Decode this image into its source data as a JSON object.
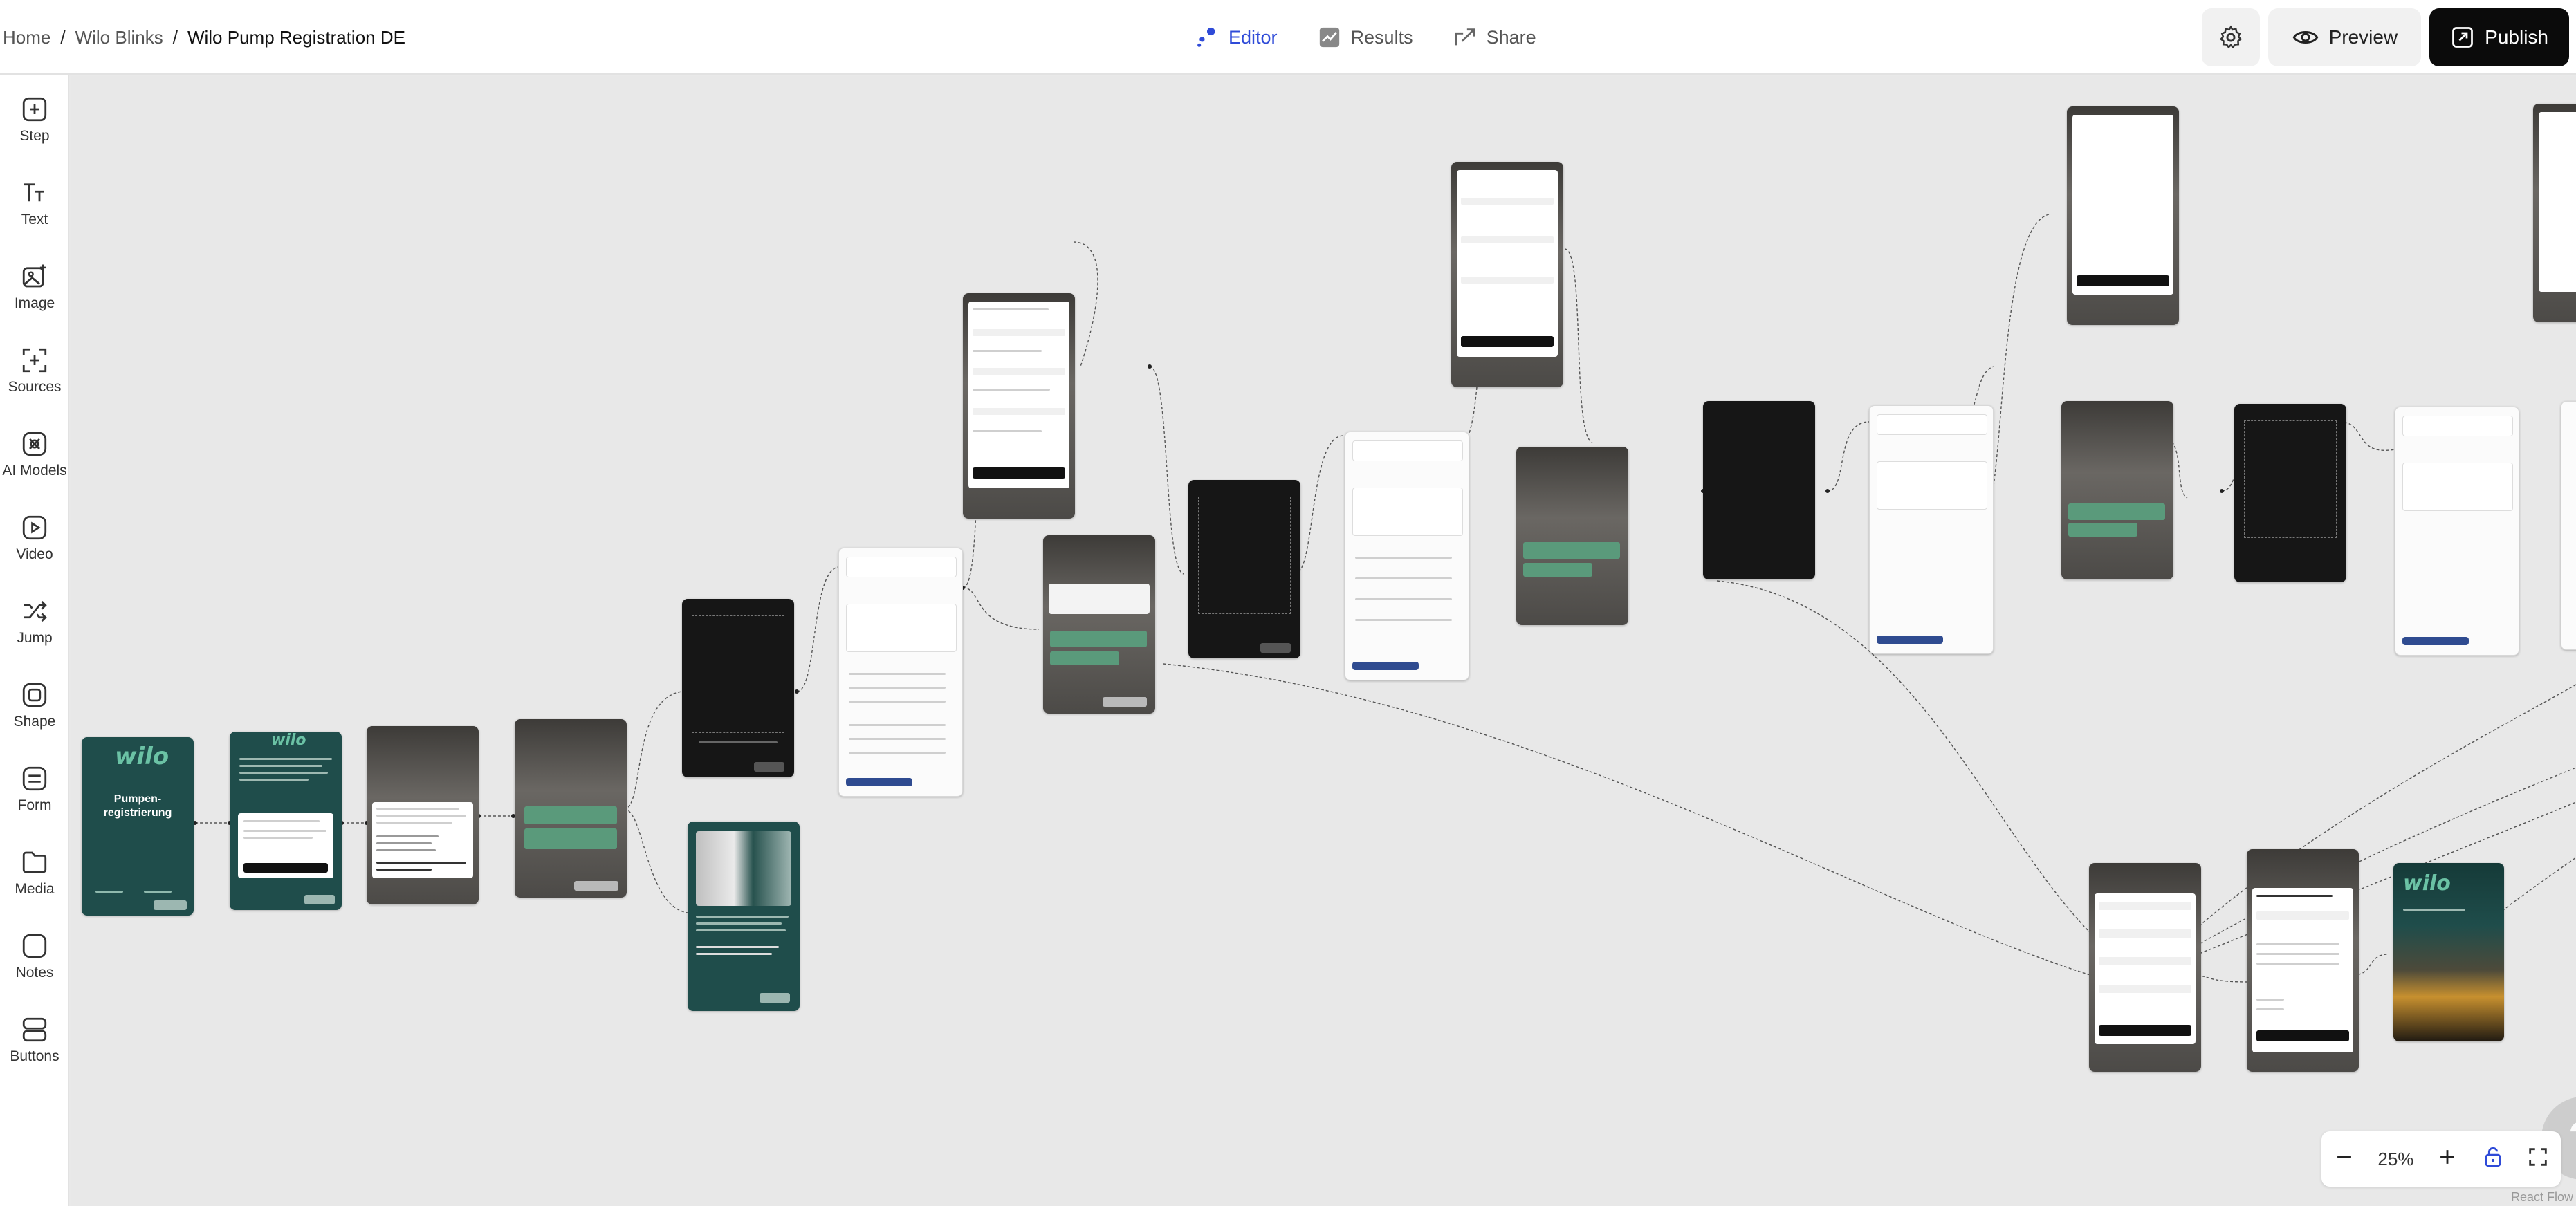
{
  "breadcrumb": {
    "home": "Home",
    "project": "Wilo Blinks",
    "current": "Wilo Pump Registration DE"
  },
  "tabs": [
    {
      "label": "Editor"
    },
    {
      "label": "Results"
    },
    {
      "label": "Share"
    }
  ],
  "actions": {
    "preview": "Preview",
    "publish": "Publish"
  },
  "tools": [
    "Step",
    "Text",
    "Image",
    "Sources",
    "AI Models",
    "Video",
    "Jump",
    "Shape",
    "Form",
    "Media",
    "Notes",
    "Buttons"
  ],
  "zoom": {
    "level": "25%"
  },
  "help": {
    "symbol": "?"
  },
  "footer": {
    "attribution": "React Flow"
  },
  "nodes": {
    "intro_title": "Pumpen-\nregistrierung",
    "brand": "wilo",
    "scan": "Continue"
  },
  "colors": {
    "accent": "#2f4bd8",
    "teal": "#1f4d4b",
    "green": "#5a9a7b"
  }
}
